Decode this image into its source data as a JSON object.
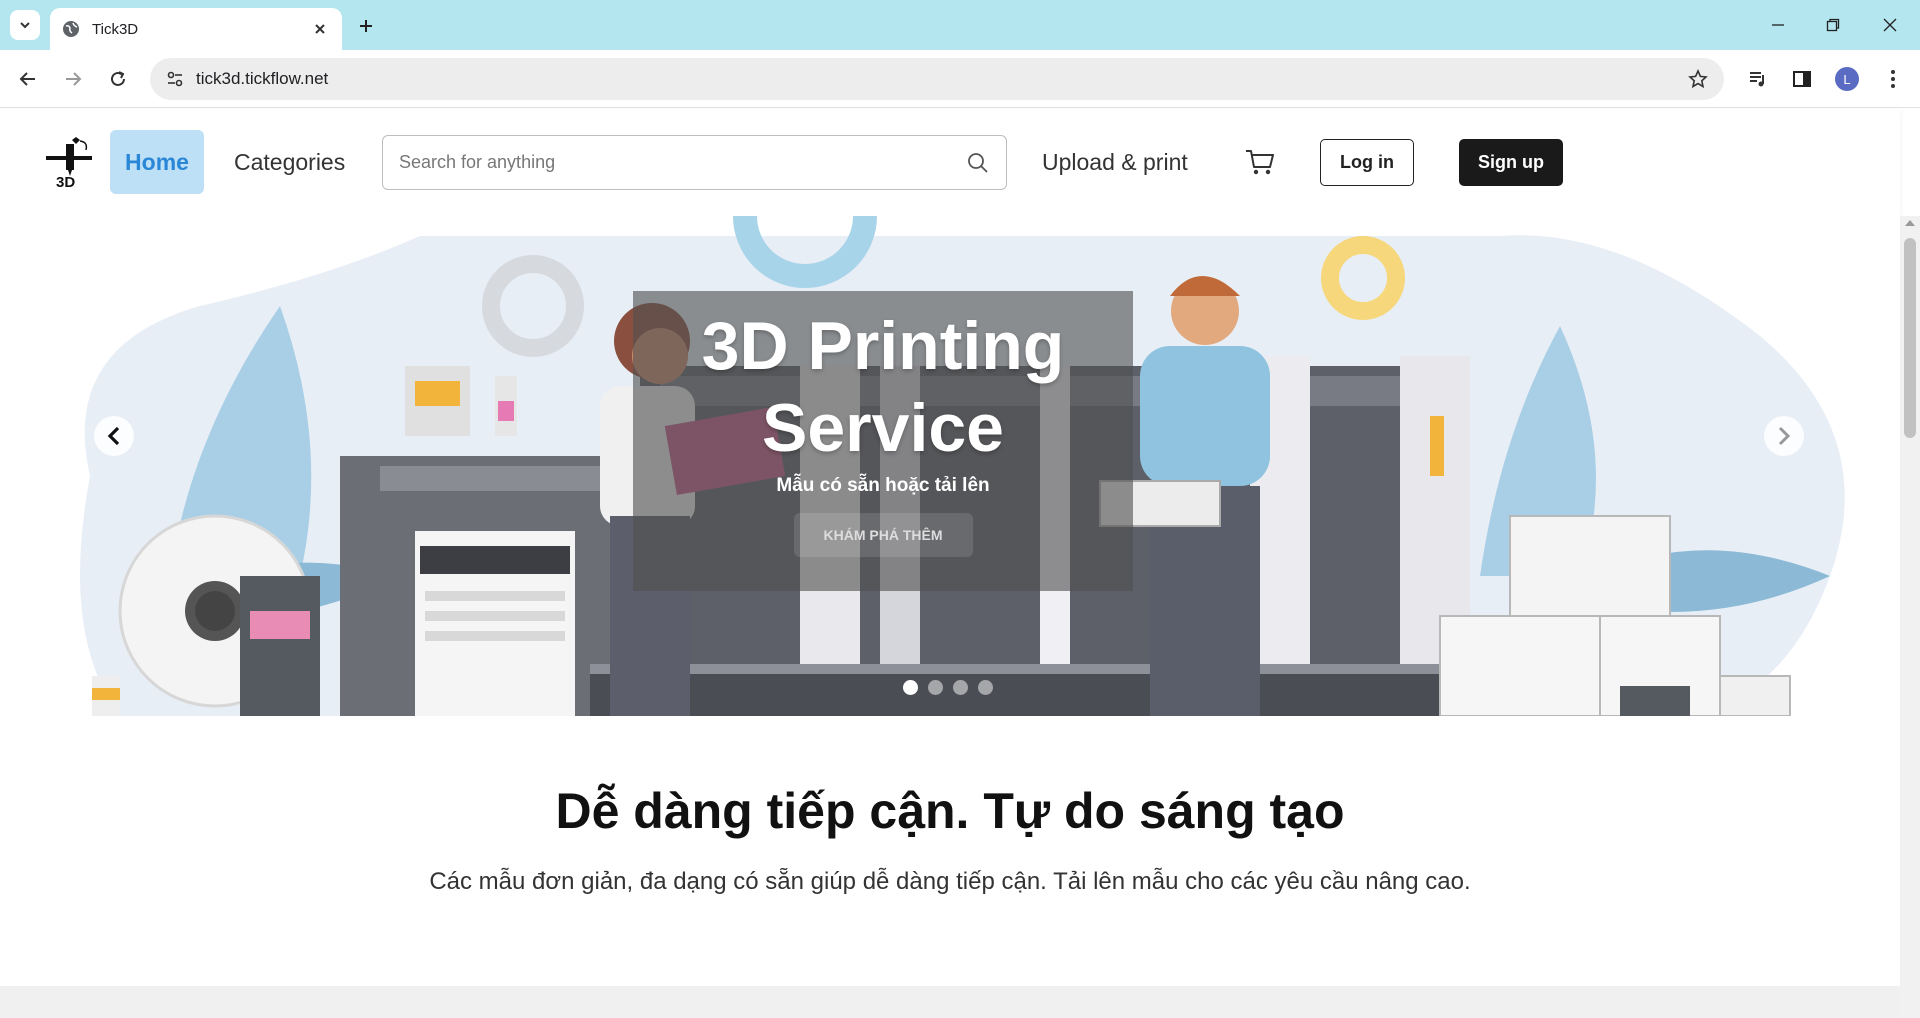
{
  "browser": {
    "tab_title": "Tick3D",
    "url": "tick3d.tickflow.net",
    "profile_initial": "L"
  },
  "header": {
    "logo_text": "3D",
    "nav_home": "Home",
    "nav_categories": "Categories",
    "search_placeholder": "Search for anything",
    "nav_upload": "Upload & print",
    "login": "Log in",
    "signup": "Sign up"
  },
  "hero": {
    "title": "3D Printing Service",
    "subtitle": "Mẫu có sẵn hoặc tải lên",
    "cta": "KHÁM PHÁ THÊM",
    "slide_count": 4,
    "active_slide": 1
  },
  "section": {
    "heading": "Dễ dàng tiếp cận. Tự do sáng tạo",
    "description": "Các mẫu đơn giản, đa dạng có sẵn giúp dễ dàng tiếp cận. Tải lên mẫu cho các yêu cầu nâng cao."
  },
  "colors": {
    "accent": "#2a86d6",
    "home_bg": "#bee0f6",
    "tabbar": "#b3e6ef",
    "signup_bg": "#1a1a1a"
  }
}
